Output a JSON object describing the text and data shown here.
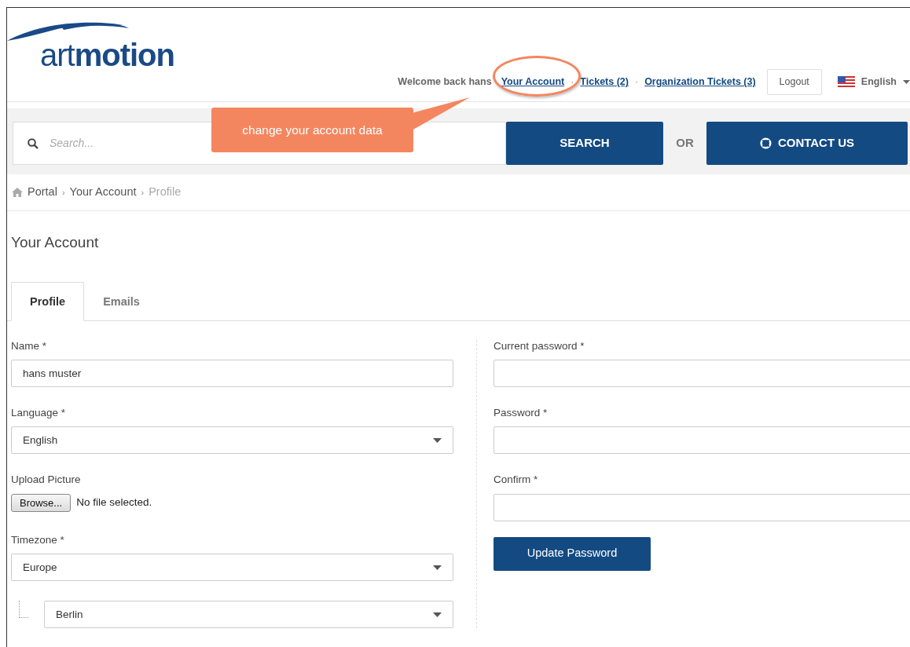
{
  "logo": {
    "light": "art",
    "bold": "motion"
  },
  "top_nav": {
    "welcome": "Welcome back hans",
    "links": [
      {
        "label": "Your Account",
        "circled": true
      },
      {
        "label": "Tickets (2)",
        "separator": "·",
        "circled": false
      },
      {
        "label": "Organization Tickets (3)",
        "separator": "·",
        "circled": false
      }
    ],
    "logout": "Logout",
    "language": "English"
  },
  "callout": "change your account data",
  "search": {
    "placeholder": "Search...",
    "button": "SEARCH",
    "or": "OR",
    "contact": "CONTACT US"
  },
  "breadcrumb": [
    {
      "label": "Portal",
      "kind": "home",
      "current": false
    },
    {
      "label": "Your Account",
      "kind": "link",
      "separator": "›",
      "current": false
    },
    {
      "label": "Profile",
      "kind": "link",
      "separator": "›",
      "current": true
    }
  ],
  "page_title": "Your Account",
  "tabs": [
    {
      "label": "Profile",
      "selected": true
    },
    {
      "label": "Emails",
      "selected": false
    }
  ],
  "left_fields": [
    {
      "kind": "text",
      "label": "Name *",
      "value": "hans muster"
    },
    {
      "kind": "select",
      "label": "Language *",
      "value": "English"
    },
    {
      "kind": "file",
      "label": "Upload Picture",
      "button": "Browse...",
      "status": "No file selected."
    },
    {
      "kind": "select",
      "label": "Timezone *",
      "value": "Europe"
    },
    {
      "kind": "subselect",
      "value": "Berlin"
    }
  ],
  "right_fields": [
    {
      "kind": "password",
      "label": "Current password *"
    },
    {
      "kind": "password",
      "label": "Password *"
    },
    {
      "kind": "password",
      "label": "Confirm *"
    }
  ],
  "update_button": "Update Password"
}
